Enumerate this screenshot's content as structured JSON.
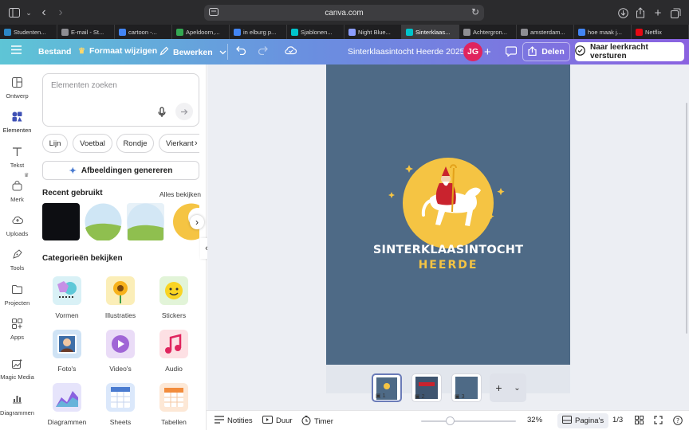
{
  "browser": {
    "url": "canva.com",
    "tabs": [
      {
        "label": "Studenten...",
        "color": "#2b86c5"
      },
      {
        "label": "E-mail - St...",
        "color": "#8e8e93"
      },
      {
        "label": "cartoon -...",
        "color": "#4285f4"
      },
      {
        "label": "Apeldoorn,...",
        "color": "#34a853"
      },
      {
        "label": "in elburg p...",
        "color": "#4285f4"
      },
      {
        "label": "Sjablonen...",
        "color": "#00c4cc"
      },
      {
        "label": "Night Blue...",
        "color": "#8c9eff"
      },
      {
        "label": "Sinterklaas...",
        "color": "#00c4cc"
      },
      {
        "label": "Achtergron...",
        "color": "#8e8e93"
      },
      {
        "label": "amsterdam...",
        "color": "#8e8e93"
      },
      {
        "label": "hoe maak j...",
        "color": "#4285f4"
      },
      {
        "label": "Netflix",
        "color": "#e50914"
      }
    ]
  },
  "header": {
    "file_label": "Bestand",
    "resize_label": "Formaat wijzigen",
    "edit_label": "Bewerken",
    "doc_title": "Sinterklaasintocht Heerde 2025",
    "avatar_initials": "JG",
    "share_label": "Delen",
    "send_label": "Naar leerkracht versturen"
  },
  "rail": [
    {
      "label": "Ontwerp",
      "icon": "layout-icon"
    },
    {
      "label": "Elementen",
      "icon": "shapes-icon"
    },
    {
      "label": "Tekst",
      "icon": "text-icon"
    },
    {
      "label": "Merk",
      "icon": "brand-icon"
    },
    {
      "label": "Uploads",
      "icon": "cloud-upload-icon"
    },
    {
      "label": "Tools",
      "icon": "pen-tool-icon"
    },
    {
      "label": "Projecten",
      "icon": "folder-icon"
    },
    {
      "label": "Apps",
      "icon": "apps-grid-icon"
    },
    {
      "label": "Magic Media",
      "icon": "magic-media-icon"
    },
    {
      "label": "Diagrammen",
      "icon": "chart-icon"
    }
  ],
  "panel": {
    "search_placeholder": "Elementen zoeken",
    "chips": [
      "Lijn",
      "Voetbal",
      "Rondje",
      "Vierkant"
    ],
    "generate_label": "Afbeeldingen genereren",
    "recent_title": "Recent gebruikt",
    "see_all": "Alles bekijken",
    "categories_title": "Categorieën bekijken",
    "categories": [
      "Vormen",
      "Illustraties",
      "Stickers",
      "Foto's",
      "Video's",
      "Audio",
      "Diagrammen",
      "Sheets",
      "Tabellen"
    ]
  },
  "design": {
    "title_line1": "SINTERKLAASINTOCHT",
    "title_line2": "HEERDE",
    "bg_color": "#4e6a86",
    "accent_color": "#f5c443"
  },
  "pages": {
    "items": [
      "1",
      "2",
      "3"
    ],
    "page_indicator": "1/3"
  },
  "bottom": {
    "notes_label": "Notities",
    "duration_label": "Duur",
    "timer_label": "Timer",
    "zoom": "32%",
    "pages_label": "Pagina's"
  }
}
